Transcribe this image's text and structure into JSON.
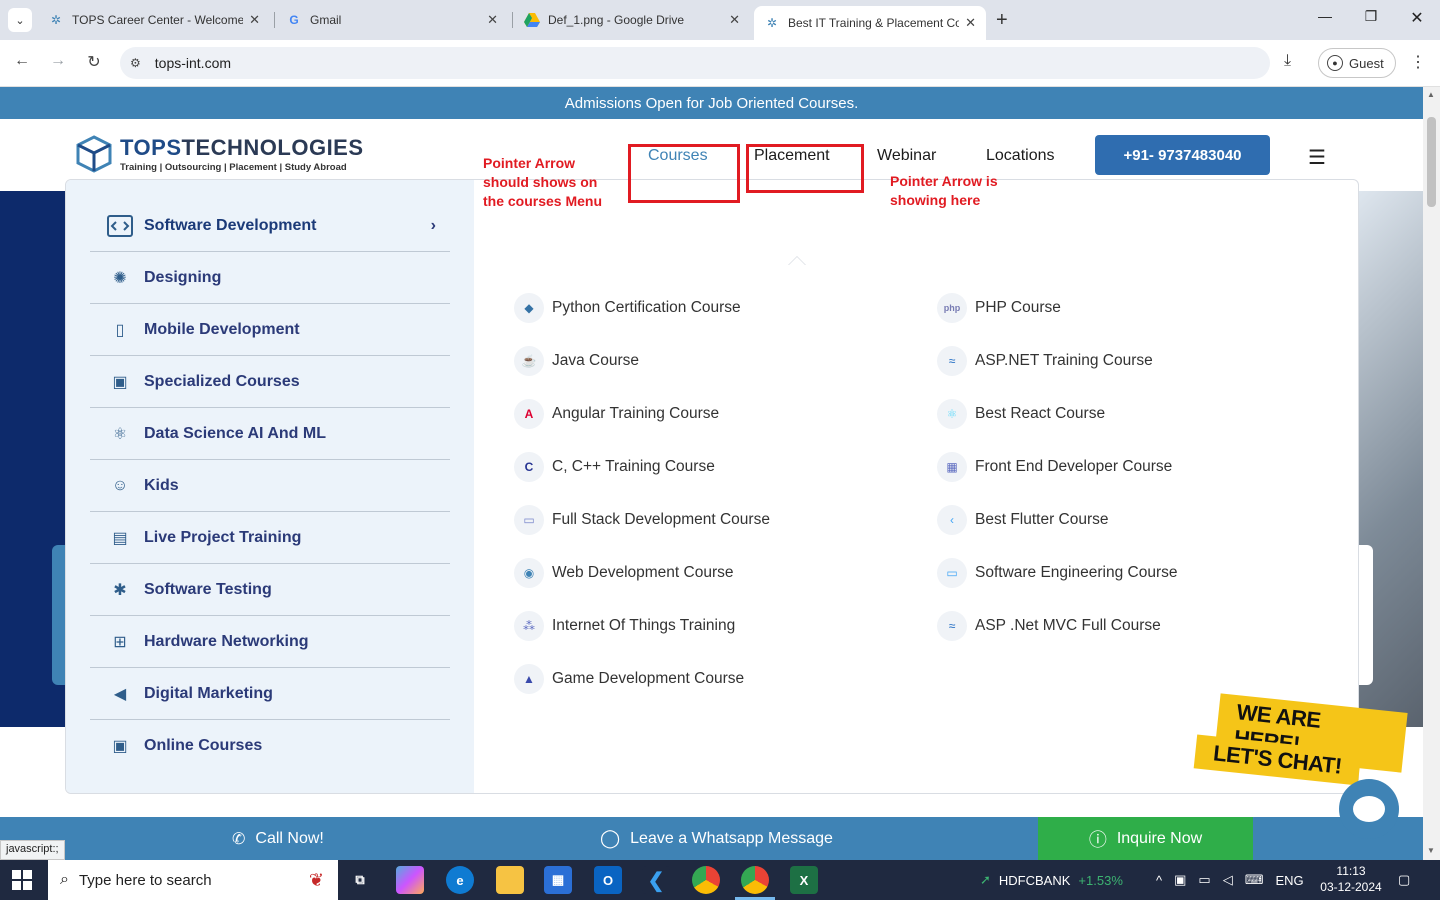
{
  "browser": {
    "tabs": [
      {
        "title": "TOPS Career Center - Welcome",
        "icon": "tops-favicon"
      },
      {
        "title": "Gmail",
        "icon": "google-g-icon"
      },
      {
        "title": "Def_1.png - Google Drive",
        "icon": "google-drive-icon"
      },
      {
        "title": "Best IT Training & Placement Co",
        "icon": "tops-favicon",
        "active": true
      }
    ],
    "url": "tops-int.com",
    "profile_label": "Guest"
  },
  "site": {
    "banner": "Admissions Open for Job Oriented Courses.",
    "logo": {
      "title_a": "TOPS",
      "title_b": "TECHNOLOGIES",
      "tagline": "Training  |  Outsourcing  |  Placement  |  Study Abroad"
    },
    "nav": {
      "courses": "Courses",
      "placement": "Placement",
      "webinar": "Webinar",
      "locations": "Locations",
      "phone": "+91- 9737483040"
    },
    "menu": {
      "categories": [
        {
          "label": "Software Development",
          "icon": "code-window-icon"
        },
        {
          "label": "Designing",
          "icon": "design-gear-icon"
        },
        {
          "label": "Mobile Development",
          "icon": "mobile-icon"
        },
        {
          "label": "Specialized Courses",
          "icon": "certificate-icon"
        },
        {
          "label": "Data Science AI And ML",
          "icon": "atom-icon"
        },
        {
          "label": "Kids",
          "icon": "brain-head-icon"
        },
        {
          "label": "Live Project Training",
          "icon": "presenter-icon"
        },
        {
          "label": "Software Testing",
          "icon": "bug-icon"
        },
        {
          "label": "Hardware Networking",
          "icon": "network-icon"
        },
        {
          "label": "Digital Marketing",
          "icon": "megaphone-icon"
        },
        {
          "label": "Online Courses",
          "icon": "online-user-icon"
        }
      ],
      "courses_left": [
        {
          "label": "Python Certification Course",
          "icon": "python-icon"
        },
        {
          "label": "Java Course",
          "icon": "java-icon"
        },
        {
          "label": "Angular Training Course",
          "icon": "angular-icon"
        },
        {
          "label": "C, C++ Training Course",
          "icon": "c-lang-icon"
        },
        {
          "label": "Full Stack Development Course",
          "icon": "monitor-icon"
        },
        {
          "label": "Web Development Course",
          "icon": "web-icon"
        },
        {
          "label": "Internet Of Things Training",
          "icon": "iot-icon"
        },
        {
          "label": "Game Development Course",
          "icon": "rocket-icon"
        }
      ],
      "courses_right": [
        {
          "label": "PHP Course",
          "icon": "php-icon"
        },
        {
          "label": "ASP.NET Training Course",
          "icon": "aspnet-icon"
        },
        {
          "label": "Best React Course",
          "icon": "react-icon"
        },
        {
          "label": "Front End Developer Course",
          "icon": "frontend-icon"
        },
        {
          "label": "Best Flutter Course",
          "icon": "flutter-icon"
        },
        {
          "label": "Software Engineering Course",
          "icon": "monitor-icon"
        },
        {
          "label": "ASP .Net MVC Full Course",
          "icon": "aspnet-icon"
        }
      ]
    },
    "annotations": {
      "left_a": "Pointer Arrow",
      "left_b": "should shows on",
      "left_c": "the courses Menu",
      "right_a": "Pointer Arrow is",
      "right_b": "showing here"
    },
    "chat": {
      "line1": "WE ARE HERE!",
      "line2": "LET'S CHAT!"
    },
    "bottom": {
      "call": "Call Now!",
      "whatsapp": "Leave a Whatsapp Message",
      "inquire": "Inquire Now"
    },
    "status_url": "javascript:;"
  },
  "taskbar": {
    "search_placeholder": "Type here to search",
    "stock_name": "HDFCBANK",
    "stock_change": "+1.53%",
    "lang": "ENG",
    "time": "11:13",
    "date": "03-12-2024"
  },
  "colors": {
    "brand_blue": "#3f83b5",
    "annotation_red": "#e11b22",
    "inquire_green": "#2fae49"
  }
}
